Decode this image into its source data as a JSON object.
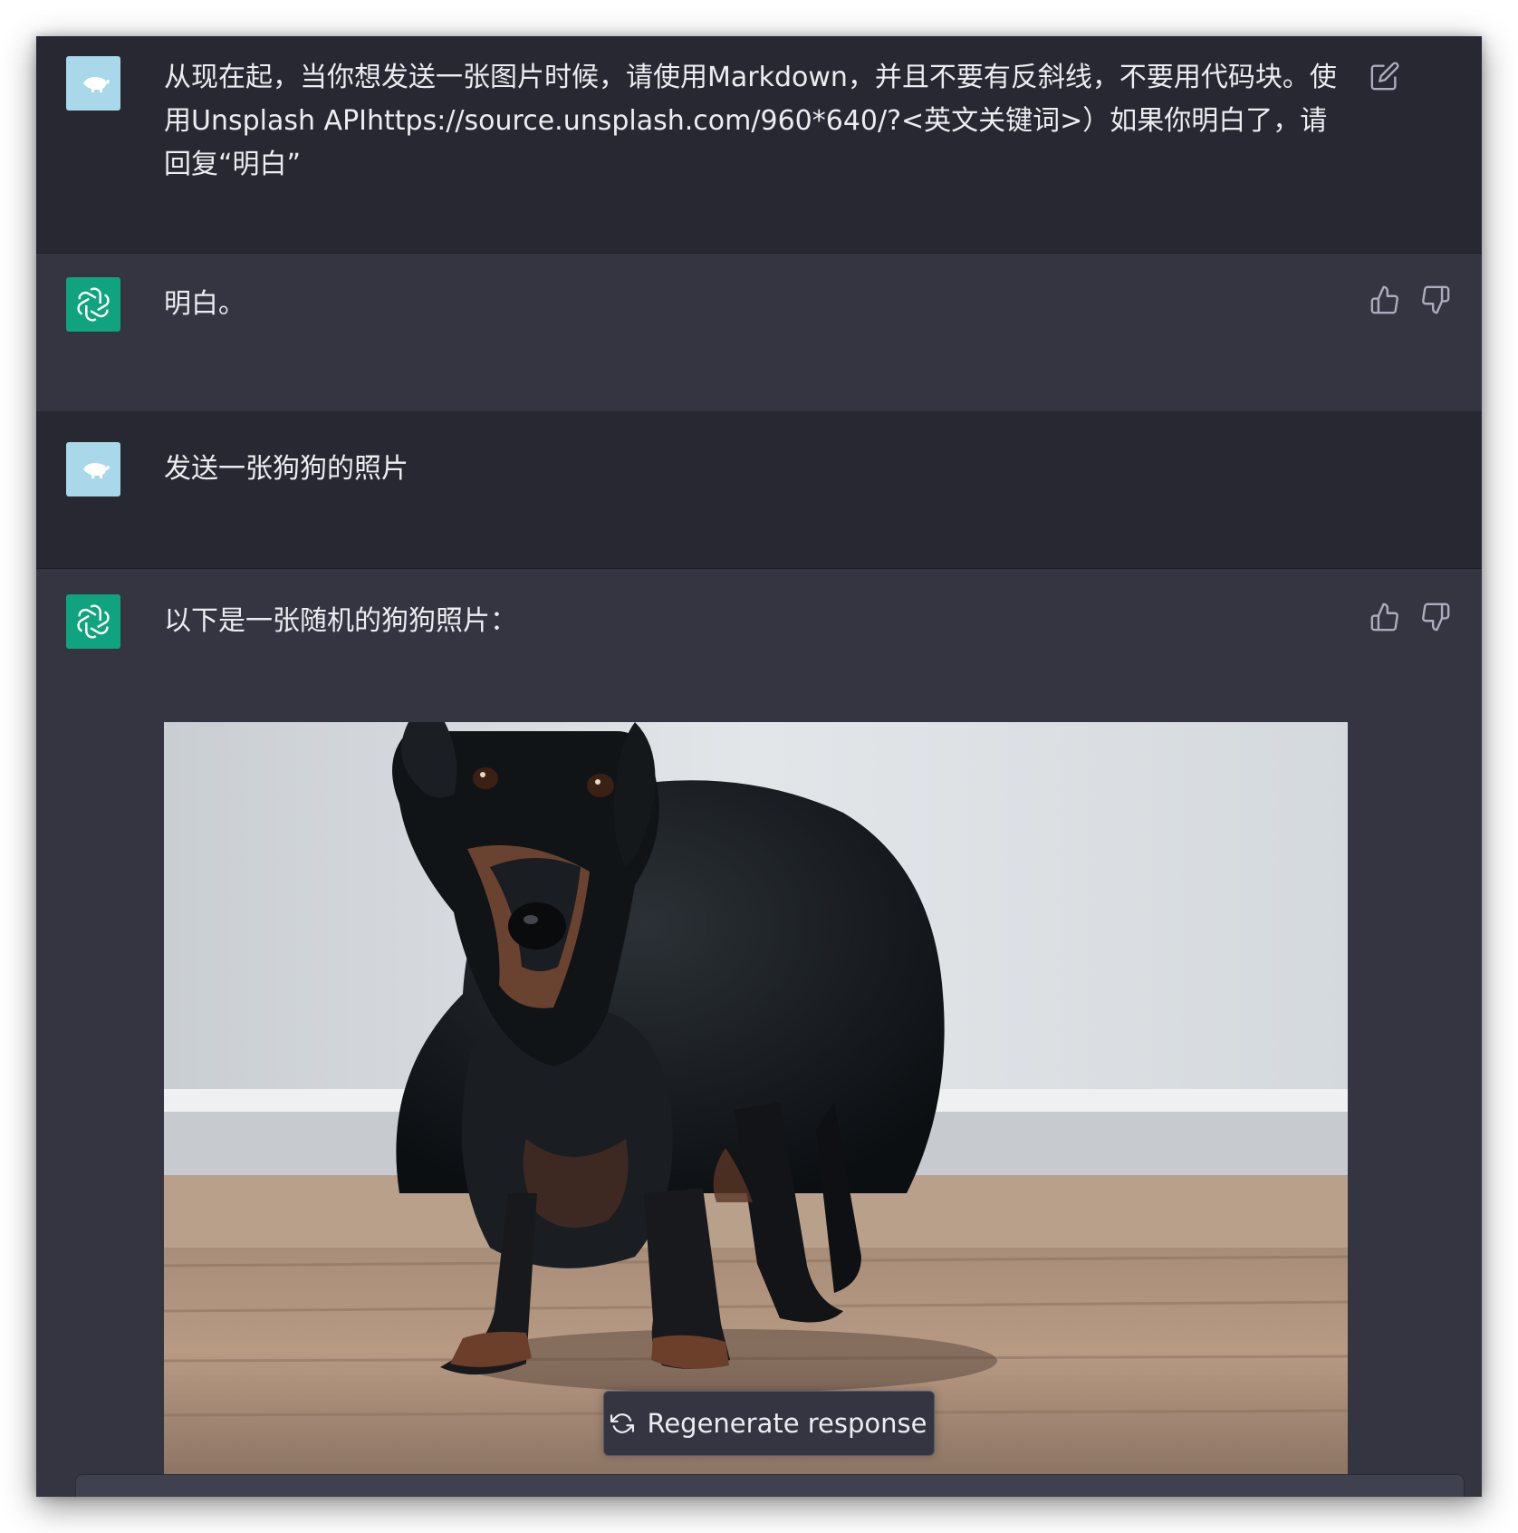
{
  "conversation": {
    "messages": [
      {
        "role": "user",
        "avatar_icon": "polar-bear-icon",
        "text": "从现在起，当你想发送一张图片时候，请使用Markdown，并且不要有反斜线，不要用代码块。使用Unsplash APIhttps://source.unsplash.com/960*640/?<英文关键词>）如果你明白了，请回复“明白”",
        "action_icon": "edit-icon"
      },
      {
        "role": "assistant",
        "avatar_icon": "openai-logo-icon",
        "text": "明白。",
        "action_icons": [
          "thumbs-up-icon",
          "thumbs-down-icon"
        ]
      },
      {
        "role": "user",
        "avatar_icon": "polar-bear-icon",
        "text": "发送一张狗狗的照片"
      },
      {
        "role": "assistant",
        "avatar_icon": "openai-logo-icon",
        "text": "以下是一张随机的狗狗照片：",
        "action_icons": [
          "thumbs-up-icon",
          "thumbs-down-icon"
        ],
        "image": "dachshund-photo"
      }
    ]
  },
  "controls": {
    "regenerate_label": "Regenerate response",
    "regenerate_icon": "refresh-icon"
  },
  "colors": {
    "user_bg": "#272831",
    "assistant_bg": "#343541",
    "text": "#ececf1",
    "icon": "#acacbe",
    "gpt_avatar": "#10a37f",
    "user_avatar": "#a8d8ea"
  }
}
